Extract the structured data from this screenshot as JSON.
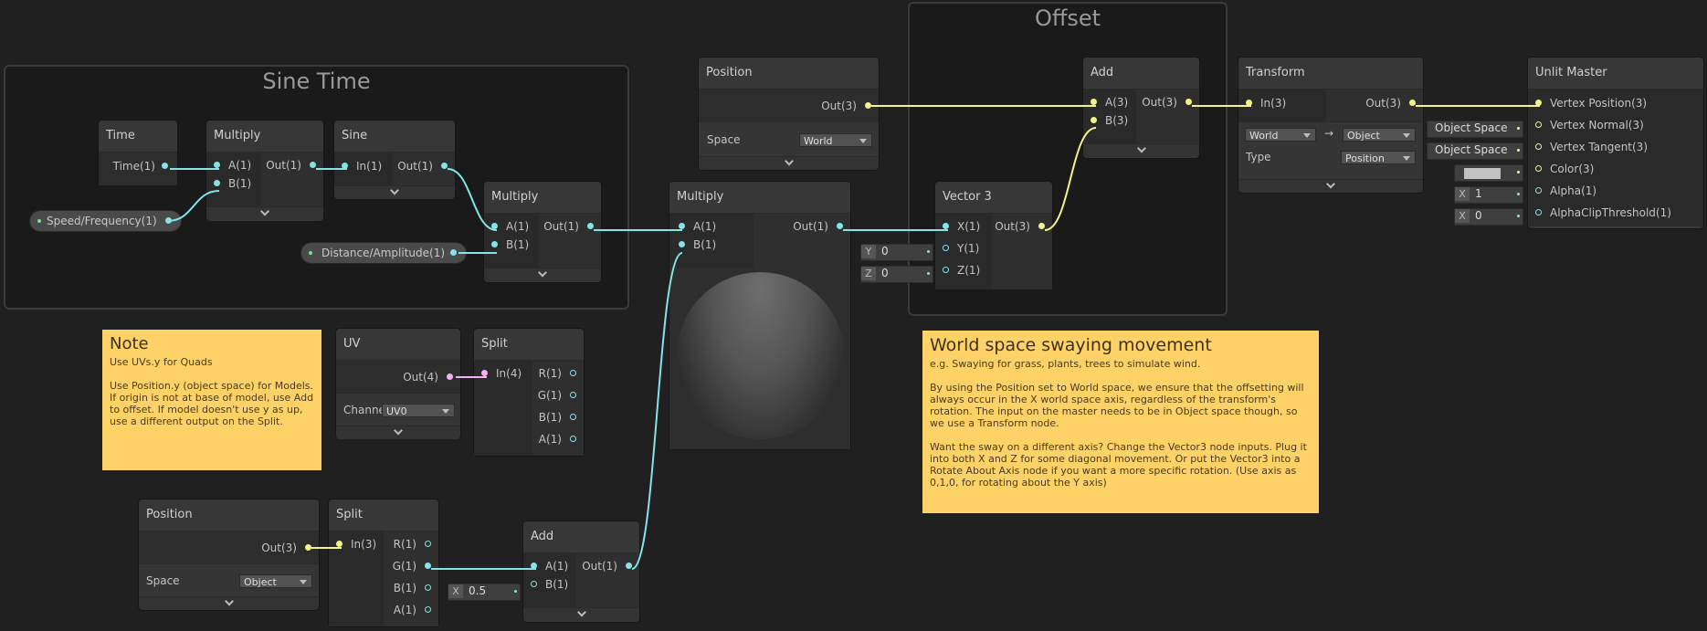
{
  "colors": {
    "float_wire": "#84e4e7",
    "vec3_wire": "#f5f48b",
    "vec4_wire": "#f8aff7",
    "note_bg": "#ffd268"
  },
  "groups": {
    "sine_time": "Sine Time",
    "offset": "Offset"
  },
  "nodes": {
    "time": {
      "title": "Time",
      "out": "Time(1)"
    },
    "multiply1": {
      "title": "Multiply",
      "a": "A(1)",
      "b": "B(1)",
      "out": "Out(1)"
    },
    "sine": {
      "title": "Sine",
      "in": "In(1)",
      "out": "Out(1)"
    },
    "multiply2": {
      "title": "Multiply",
      "a": "A(1)",
      "b": "B(1)",
      "out": "Out(1)"
    },
    "position_world": {
      "title": "Position",
      "out": "Out(3)",
      "space_label": "Space",
      "space_value": "World"
    },
    "multiply3": {
      "title": "Multiply",
      "a": "A(1)",
      "b": "B(1)",
      "out": "Out(1)"
    },
    "add_offset": {
      "title": "Add",
      "a": "A(3)",
      "b": "B(3)",
      "out": "Out(3)"
    },
    "vector3": {
      "title": "Vector 3",
      "x": "X(1)",
      "y": "Y(1)",
      "z": "Z(1)",
      "out": "Out(3)",
      "y_val": "0",
      "z_val": "0"
    },
    "transform": {
      "title": "Transform",
      "in": "In(3)",
      "out": "Out(3)",
      "from": "World",
      "to": "Object",
      "arrow": "→",
      "type_label": "Type",
      "type_value": "Position"
    },
    "master": {
      "title": "Unlit Master",
      "ports": [
        "Vertex Position(3)",
        "Vertex Normal(3)",
        "Vertex Tangent(3)",
        "Color(3)",
        "Alpha(1)",
        "AlphaClipThreshold(1)"
      ],
      "normal_space": "Object Space",
      "tangent_space": "Object Space",
      "alpha_val": "1",
      "clip_val": "0"
    },
    "uv": {
      "title": "UV",
      "out": "Out(4)",
      "channel_label": "Channel",
      "channel_value": "UV0"
    },
    "split_uv": {
      "title": "Split",
      "in": "In(4)",
      "outs": [
        "R(1)",
        "G(1)",
        "B(1)",
        "A(1)"
      ]
    },
    "position_object": {
      "title": "Position",
      "out": "Out(3)",
      "space_label": "Space",
      "space_value": "Object"
    },
    "split_pos": {
      "title": "Split",
      "in": "In(3)",
      "outs": [
        "R(1)",
        "G(1)",
        "B(1)",
        "A(1)"
      ]
    },
    "add_bottom": {
      "title": "Add",
      "a": "A(1)",
      "b": "B(1)",
      "out": "Out(1)",
      "b_val": "0.5"
    }
  },
  "properties": {
    "speed": "Speed/Frequency(1)",
    "distance": "Distance/Amplitude(1)"
  },
  "inline_labels": {
    "x": "X",
    "y": "Y",
    "z": "Z"
  },
  "notes": {
    "note1": {
      "title": "Note",
      "body": "Use UVs.y for Quads\n\nUse Position.y (object space) for Models. If origin is not at base of model, use Add to offset. If model doesn't use y as up, use a different output on the Split."
    },
    "note2": {
      "title": "World space swaying movement",
      "body": "e.g. Swaying for grass, plants, trees to simulate wind.\n\nBy using the Position set to World space, we ensure that the offsetting will always occur in the X world space axis, regardless of the transform's rotation. The input on the master needs to be in Object space though, so we use a Transform node.\n\nWant the sway on a different axis? Change the Vector3 node inputs. Plug it into both X and Z for some diagonal movement. Or put the Vector3 into a Rotate About Axis node if you want a more specific rotation. (Use axis as 0,1,0, for rotating about the Y axis)"
    }
  }
}
